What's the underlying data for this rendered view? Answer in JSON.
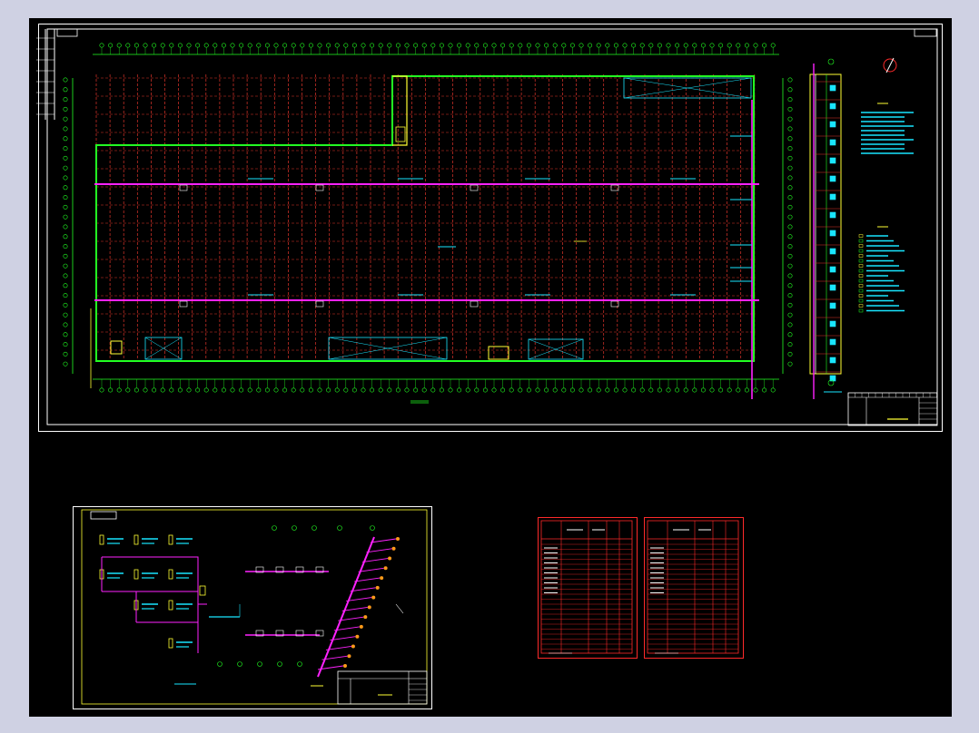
{
  "colors": {
    "background_outer": "#cfd1e3",
    "canvas": "#000000",
    "frame": "#ffffff",
    "grid_red": "#e0352b",
    "axis_green": "#22ff22",
    "pipe_magenta": "#ff22ff",
    "text_cyan": "#19e6ff",
    "annot_yellow": "#ffff33",
    "table_red": "#ff2a2a",
    "accent_orange": "#ff9a1a"
  },
  "icons": {
    "north_arrow": "north-arrow-icon"
  }
}
